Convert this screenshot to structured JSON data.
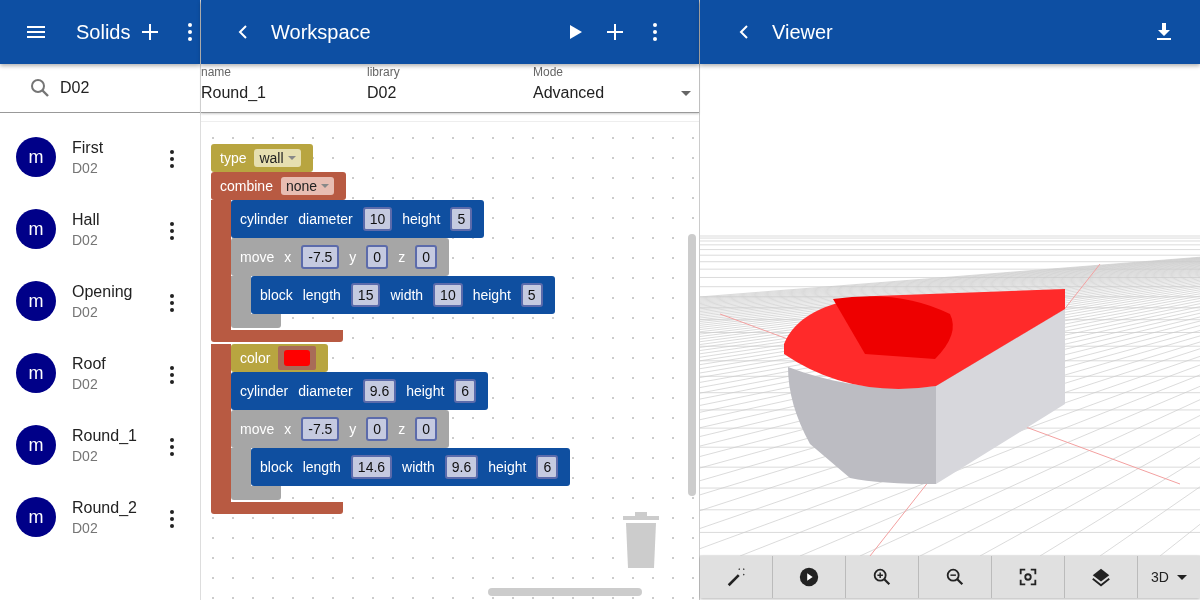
{
  "sidebar": {
    "title": "Solids",
    "search": {
      "value": "D02"
    },
    "items": [
      {
        "avatar": "m",
        "name": "First",
        "library": "D02"
      },
      {
        "avatar": "m",
        "name": "Hall",
        "library": "D02"
      },
      {
        "avatar": "m",
        "name": "Opening",
        "library": "D02"
      },
      {
        "avatar": "m",
        "name": "Roof",
        "library": "D02"
      },
      {
        "avatar": "m",
        "name": "Round_1",
        "library": "D02"
      },
      {
        "avatar": "m",
        "name": "Round_2",
        "library": "D02"
      }
    ]
  },
  "workspace": {
    "title": "Workspace",
    "fields": [
      {
        "kind": "text",
        "label": "name",
        "value": "Round_1"
      },
      {
        "kind": "text",
        "label": "library",
        "value": "D02"
      },
      {
        "kind": "select",
        "label": "Mode",
        "value": "Advanced"
      }
    ],
    "blocks": [
      {
        "kind": "type",
        "parts": [
          {
            "kind": "label",
            "text": "type"
          },
          {
            "kind": "dropdown",
            "text": "wall"
          }
        ]
      },
      {
        "kind": "combine",
        "parts": [
          {
            "kind": "label",
            "text": "combine"
          },
          {
            "kind": "dropdown",
            "text": "none"
          }
        ],
        "sections": [
          [
            {
              "kind": "shape",
              "parts": [
                {
                  "kind": "label",
                  "text": "cylinder"
                },
                {
                  "kind": "label",
                  "text": "diameter"
                },
                {
                  "kind": "number",
                  "text": "10"
                },
                {
                  "kind": "label",
                  "text": "height"
                },
                {
                  "kind": "number",
                  "text": "5"
                }
              ]
            },
            {
              "kind": "move",
              "parts": [
                {
                  "kind": "label",
                  "text": "move"
                },
                {
                  "kind": "label",
                  "text": "x"
                },
                {
                  "kind": "number",
                  "text": "-7.5"
                },
                {
                  "kind": "label",
                  "text": "y"
                },
                {
                  "kind": "number",
                  "text": "0"
                },
                {
                  "kind": "label",
                  "text": "z"
                },
                {
                  "kind": "number",
                  "text": "0"
                }
              ],
              "sections": [
                [
                  {
                    "kind": "shape",
                    "parts": [
                      {
                        "kind": "label",
                        "text": "block"
                      },
                      {
                        "kind": "label",
                        "text": "length"
                      },
                      {
                        "kind": "number",
                        "text": "15"
                      },
                      {
                        "kind": "label",
                        "text": "width"
                      },
                      {
                        "kind": "number",
                        "text": "10"
                      },
                      {
                        "kind": "label",
                        "text": "height"
                      },
                      {
                        "kind": "number",
                        "text": "5"
                      }
                    ]
                  }
                ]
              ]
            }
          ],
          [
            {
              "kind": "type",
              "parts": [
                {
                  "kind": "label",
                  "text": "color"
                },
                {
                  "kind": "color",
                  "color": "#ff0000"
                }
              ]
            },
            {
              "kind": "shape",
              "parts": [
                {
                  "kind": "label",
                  "text": "cylinder"
                },
                {
                  "kind": "label",
                  "text": "diameter"
                },
                {
                  "kind": "number",
                  "text": "9.6"
                },
                {
                  "kind": "label",
                  "text": "height"
                },
                {
                  "kind": "number",
                  "text": "6"
                }
              ]
            },
            {
              "kind": "move",
              "parts": [
                {
                  "kind": "label",
                  "text": "move"
                },
                {
                  "kind": "label",
                  "text": "x"
                },
                {
                  "kind": "number",
                  "text": "-7.5"
                },
                {
                  "kind": "label",
                  "text": "y"
                },
                {
                  "kind": "number",
                  "text": "0"
                },
                {
                  "kind": "label",
                  "text": "z"
                },
                {
                  "kind": "number",
                  "text": "0"
                }
              ],
              "sections": [
                [
                  {
                    "kind": "shape",
                    "parts": [
                      {
                        "kind": "label",
                        "text": "block"
                      },
                      {
                        "kind": "label",
                        "text": "length"
                      },
                      {
                        "kind": "number",
                        "text": "14.6"
                      },
                      {
                        "kind": "label",
                        "text": "width"
                      },
                      {
                        "kind": "number",
                        "text": "9.6"
                      },
                      {
                        "kind": "label",
                        "text": "height"
                      },
                      {
                        "kind": "number",
                        "text": "6"
                      }
                    ]
                  }
                ]
              ]
            }
          ]
        ]
      }
    ]
  },
  "viewer": {
    "title": "Viewer",
    "tools": [
      {
        "kind": "wand"
      },
      {
        "kind": "play"
      },
      {
        "kind": "zoom-in"
      },
      {
        "kind": "zoom-out"
      },
      {
        "kind": "focus"
      },
      {
        "kind": "layers"
      }
    ],
    "view_mode": "3D"
  }
}
